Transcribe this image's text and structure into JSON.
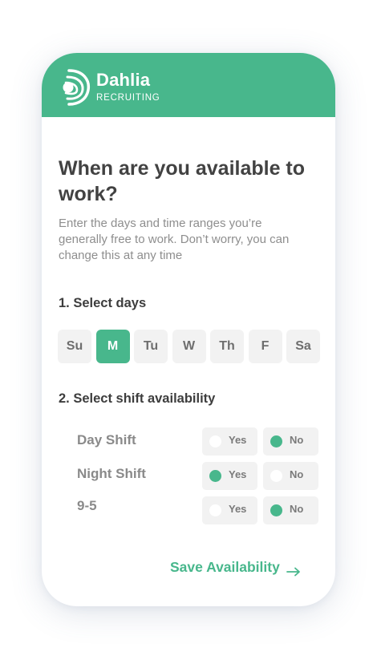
{
  "brand": {
    "name": "Dahlia",
    "subtitle": "RECRUITING",
    "color": "#48b78c",
    "logo_icon": "dahlia-logo-icon"
  },
  "question": {
    "title": "When are you available to work?",
    "description": "Enter the days and time ranges you’re generally free to work. Don’t worry, you can change this at any time"
  },
  "days_section": {
    "heading": "1. Select days",
    "days": [
      {
        "label": "Su",
        "selected": false
      },
      {
        "label": "M",
        "selected": true
      },
      {
        "label": "Tu",
        "selected": false
      },
      {
        "label": "W",
        "selected": false
      },
      {
        "label": "Th",
        "selected": false
      },
      {
        "label": "F",
        "selected": false
      },
      {
        "label": "Sa",
        "selected": false
      }
    ]
  },
  "shift_section": {
    "heading": "2. Select shift availability",
    "yes_label": "Yes",
    "no_label": "No",
    "shifts": [
      {
        "label": "Day Shift",
        "selected": "No"
      },
      {
        "label": "Night Shift",
        "selected": "Yes"
      },
      {
        "label": "9-5",
        "selected": "No"
      }
    ]
  },
  "actions": {
    "save_label": "Save Availability",
    "save_icon": "arrow-right-icon"
  }
}
